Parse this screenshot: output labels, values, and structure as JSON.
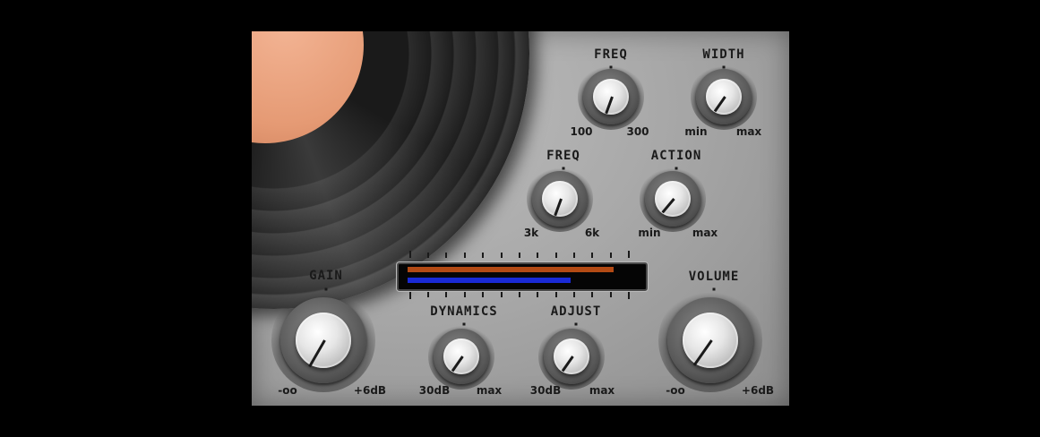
{
  "panel": {
    "record_label_text": "~~~~~~ ~~~~ ~~~~",
    "knobs": [
      {
        "id": "freq-top",
        "title": "FREQ",
        "min": "100",
        "max": "300"
      },
      {
        "id": "width",
        "title": "WIDTH",
        "min": "min",
        "max": "max"
      },
      {
        "id": "freq-mid",
        "title": "FREQ",
        "min": "3k",
        "max": "6k"
      },
      {
        "id": "action",
        "title": "ACTION",
        "min": "min",
        "max": "max"
      },
      {
        "id": "gain",
        "title": "GAIN",
        "min": "-oo",
        "max": "+6dB"
      },
      {
        "id": "dynamics",
        "title": "DYNAMICS",
        "min": "30dB",
        "max": "max"
      },
      {
        "id": "adjust",
        "title": "ADJUST",
        "min": "30dB",
        "max": "max"
      },
      {
        "id": "volume",
        "title": "VOLUME",
        "min": "-oo",
        "max": "+6dB"
      }
    ]
  },
  "meter": {
    "top_level": 0.9,
    "bottom_level": 0.71,
    "top_color": "#b34a14",
    "bottom_color": "#1a2ad6"
  },
  "colors": {
    "panel": "#a9a9a9",
    "background": "#000000",
    "record_label": "#e59a74"
  }
}
